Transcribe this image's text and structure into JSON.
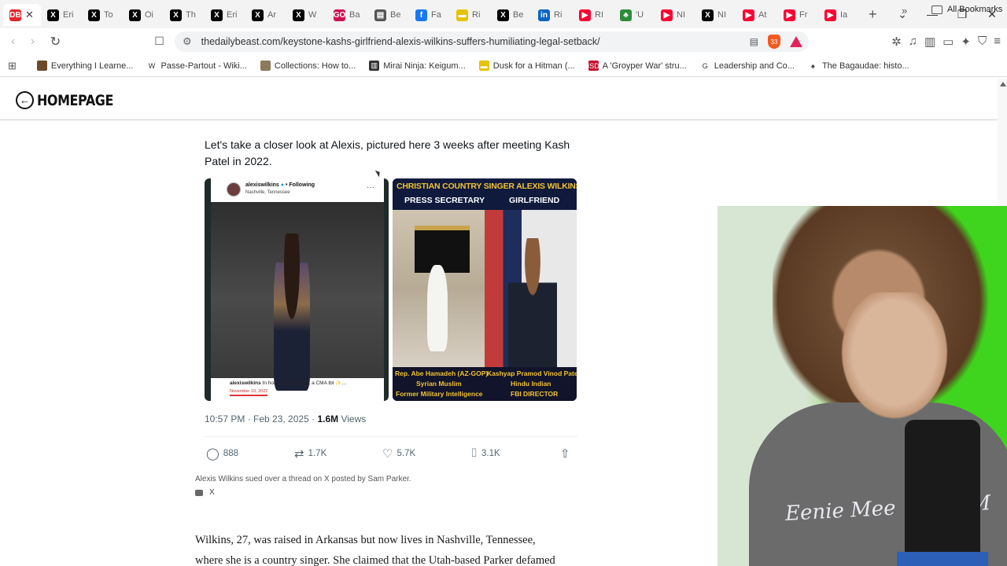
{
  "browser": {
    "tabs": [
      {
        "icon": "daily-beast",
        "label": "DB",
        "color": "#e3262b",
        "title": "",
        "active": true
      },
      {
        "icon": "x",
        "label": "X",
        "color": "#000000",
        "title": "Eri"
      },
      {
        "icon": "x",
        "label": "X",
        "color": "#000000",
        "title": "To"
      },
      {
        "icon": "x",
        "label": "X",
        "color": "#000000",
        "title": "Oi"
      },
      {
        "icon": "x",
        "label": "X",
        "color": "#000000",
        "title": "Th"
      },
      {
        "icon": "x",
        "label": "X",
        "color": "#000000",
        "title": "Eri"
      },
      {
        "icon": "x",
        "label": "X",
        "color": "#000000",
        "title": "Ar"
      },
      {
        "icon": "x",
        "label": "X",
        "color": "#000000",
        "title": "W"
      },
      {
        "icon": "go",
        "label": "GO",
        "color": "#d0114f",
        "title": "Ba"
      },
      {
        "icon": "page",
        "label": "▤",
        "color": "#555555",
        "title": "Be"
      },
      {
        "icon": "facebook",
        "label": "f",
        "color": "#1877f2",
        "title": "Fa"
      },
      {
        "icon": "bookmark-yellow",
        "label": "▬",
        "color": "#e6c200",
        "title": "Ri"
      },
      {
        "icon": "x",
        "label": "X",
        "color": "#000000",
        "title": "Be"
      },
      {
        "icon": "linkedin",
        "label": "in",
        "color": "#0a66c2",
        "title": "Ri"
      },
      {
        "icon": "youtube",
        "label": "▶",
        "color": "#ff0033",
        "title": "RI"
      },
      {
        "icon": "leaf",
        "label": "♣",
        "color": "#2e8b3a",
        "title": "'U"
      },
      {
        "icon": "youtube",
        "label": "▶",
        "color": "#ff0033",
        "title": "NI"
      },
      {
        "icon": "x",
        "label": "X",
        "color": "#000000",
        "title": "NI"
      },
      {
        "icon": "youtube",
        "label": "▶",
        "color": "#ff0033",
        "title": "At"
      },
      {
        "icon": "youtube",
        "label": "▶",
        "color": "#ff0033",
        "title": "Fr"
      },
      {
        "icon": "youtube",
        "label": "▶",
        "color": "#ff0033",
        "title": "Ia"
      }
    ],
    "url": "thedailybeast.com/keystone-kashs-girlfriend-alexis-wilkins-suffers-humiliating-legal-setback/",
    "brave_shield_count": "33",
    "bookmarks": [
      {
        "icon_color": "#6b4b2b",
        "glyph": "",
        "label": "Everything I Learne..."
      },
      {
        "icon_color": "#ffffff",
        "glyph": "W",
        "label": "Passe-Partout - Wiki..."
      },
      {
        "icon_color": "#8c7a5a",
        "glyph": "",
        "label": "Collections: How to..."
      },
      {
        "icon_color": "#333333",
        "glyph": "▥",
        "label": "Mirai Ninja: Keigum..."
      },
      {
        "icon_color": "#e6c200",
        "glyph": "▬",
        "label": "Dusk for a Hitman (..."
      },
      {
        "icon_color": "#c8102e",
        "glyph": "ISD",
        "label": "A 'Groyper War' stru..."
      },
      {
        "icon_color": "#ffffff",
        "glyph": "G",
        "label": "Leadership and Co..."
      },
      {
        "icon_color": "#ffffff",
        "glyph": "♠",
        "label": "The Bagaudae: histo..."
      }
    ],
    "all_bookmarks_label": "All Bookmarks"
  },
  "page": {
    "homepage_label": "HOMEPAGE",
    "tweet": {
      "text": "Let's take a closer look at Alexis, pictured here 3 weeks after meeting Kash Patel in 2022.",
      "image1": {
        "username": "alexiswilkins",
        "following": "• Following",
        "location": "Nashville, Tennessee",
        "caption_user": "alexiswilkins",
        "caption": "In honor of CMA szn, a CMA tbt ✨...",
        "date": "November 10, 2022"
      },
      "image2": {
        "headline": "CHRISTIAN COUNTRY SINGER ALEXIS WILKINS:",
        "left_title": "PRESS SECRETARY",
        "right_title": "GIRLFRIEND",
        "left_caption": [
          "Rep. Abe Hamadeh (AZ-GOP)",
          "Syrian Muslim",
          "Former Military Intelligence"
        ],
        "right_caption": [
          "Kashyap Pramod Vinod Patel",
          "Hindu Indian",
          "FBI DIRECTOR"
        ]
      },
      "time": "10:57 PM · Feb 23, 2025 ·",
      "views_count": "1.6M",
      "views_label": "Views",
      "replies": "888",
      "reposts": "1.7K",
      "likes": "5.7K",
      "bookmarks": "3.1K"
    },
    "photo_credit": "Alexis Wilkins sued over a thread on X posted by Sam Parker.",
    "photo_source": "X",
    "body_lines": [
      "Wilkins, 27, was raised in Arkansas but now lives in Nashville, Tennessee,",
      "where she is a country singer. She claimed that the Utah-based Parker defamed"
    ]
  },
  "webcam": {
    "shirt_text": "Eenie Mee",
    "shirt_text_2": "M"
  }
}
